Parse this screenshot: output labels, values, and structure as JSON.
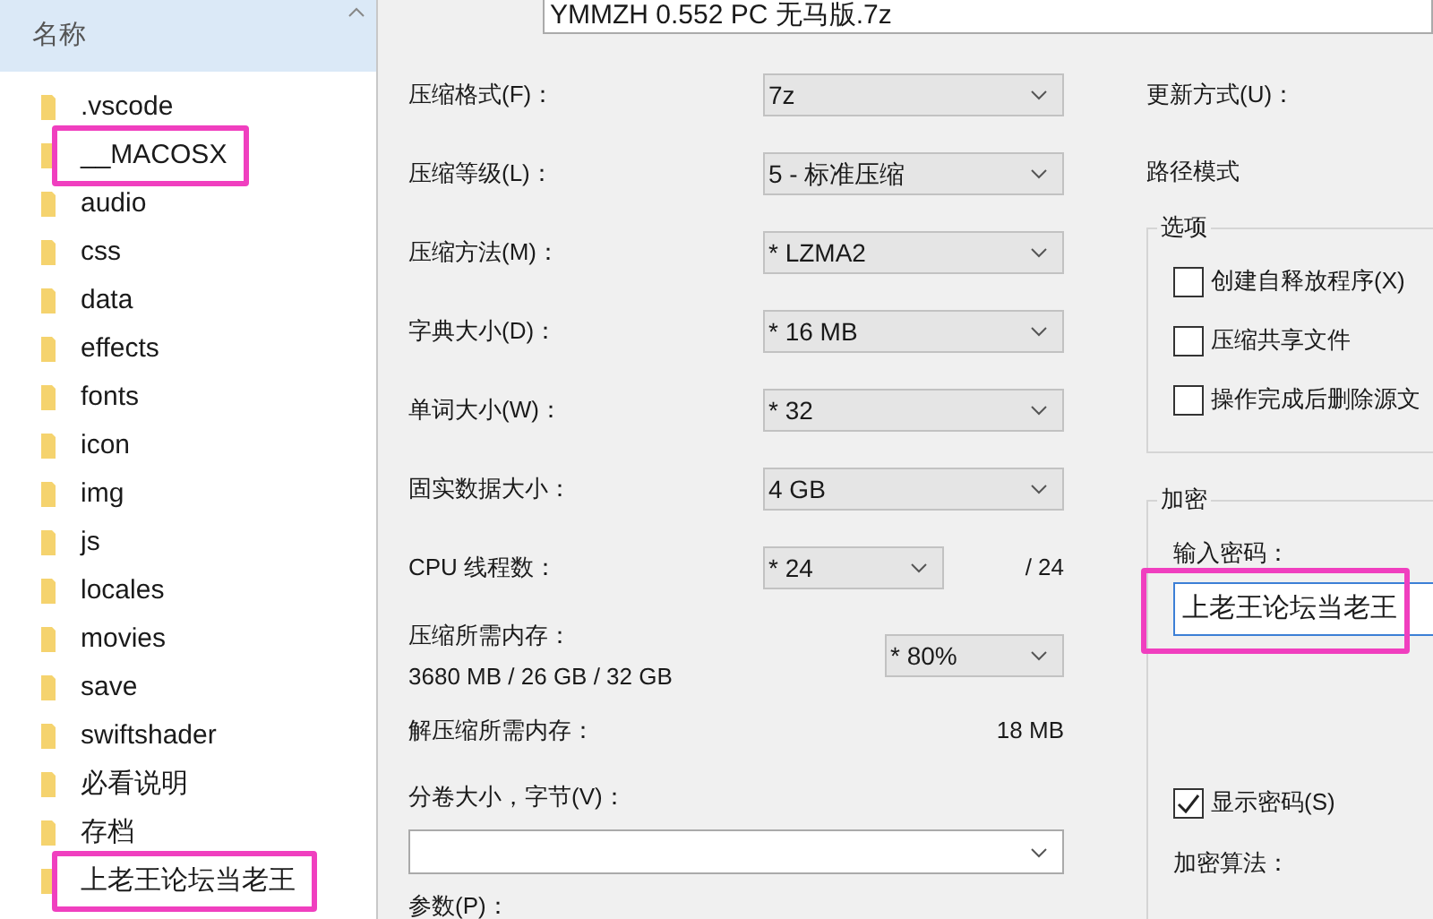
{
  "file_panel": {
    "header": "名称",
    "items": [
      {
        "name": ".vscode",
        "highlighted": false
      },
      {
        "name": "__MACOSX",
        "highlighted": true
      },
      {
        "name": "audio",
        "highlighted": false
      },
      {
        "name": "css",
        "highlighted": false
      },
      {
        "name": "data",
        "highlighted": false
      },
      {
        "name": "effects",
        "highlighted": false
      },
      {
        "name": "fonts",
        "highlighted": false
      },
      {
        "name": "icon",
        "highlighted": false
      },
      {
        "name": "img",
        "highlighted": false
      },
      {
        "name": "js",
        "highlighted": false
      },
      {
        "name": "locales",
        "highlighted": false
      },
      {
        "name": "movies",
        "highlighted": false
      },
      {
        "name": "save",
        "highlighted": false
      },
      {
        "name": "swiftshader",
        "highlighted": false
      },
      {
        "name": "必看说明",
        "highlighted": false
      },
      {
        "name": "存档",
        "highlighted": false
      },
      {
        "name": "上老王论坛当老王",
        "highlighted": true
      }
    ]
  },
  "archive_name": "YMMZH 0.552 PC 无马版.7z",
  "settings": [
    {
      "label": "压缩格式(F)：",
      "value": "7z"
    },
    {
      "label": "压缩等级(L)：",
      "value": "5 - 标准压缩"
    },
    {
      "label": "压缩方法(M)：",
      "value": "*  LZMA2"
    },
    {
      "label": "字典大小(D)：",
      "value": "*  16 MB"
    },
    {
      "label": "单词大小(W)：",
      "value": "*  32"
    },
    {
      "label": "固实数据大小：",
      "value": "4 GB"
    }
  ],
  "cpu_threads": {
    "label": "CPU 线程数：",
    "value": "*  24",
    "max": "/ 24"
  },
  "compress_memory": {
    "label": "压缩所需内存：",
    "detail": "3680 MB / 26 GB / 32 GB",
    "value": "* 80%"
  },
  "decompress_memory": {
    "label": "解压缩所需内存：",
    "value": "18 MB"
  },
  "volume_size": {
    "label": "分卷大小，字节(V)："
  },
  "parameters": {
    "label": "参数(P)："
  },
  "update_mode": {
    "label": "更新方式(U)："
  },
  "path_mode": {
    "label": "路径模式"
  },
  "options": {
    "title": "选项",
    "items": [
      {
        "label": "创建自释放程序(X)",
        "checked": false
      },
      {
        "label": "压缩共享文件",
        "checked": false
      },
      {
        "label": "操作完成后删除源文",
        "checked": false
      }
    ]
  },
  "encryption": {
    "title": "加密",
    "password_label": "输入密码：",
    "password": "上老王论坛当老王",
    "password_highlighted": true,
    "show_password": {
      "label": "显示密码(S)",
      "checked": true
    },
    "method_label": "加密算法："
  }
}
